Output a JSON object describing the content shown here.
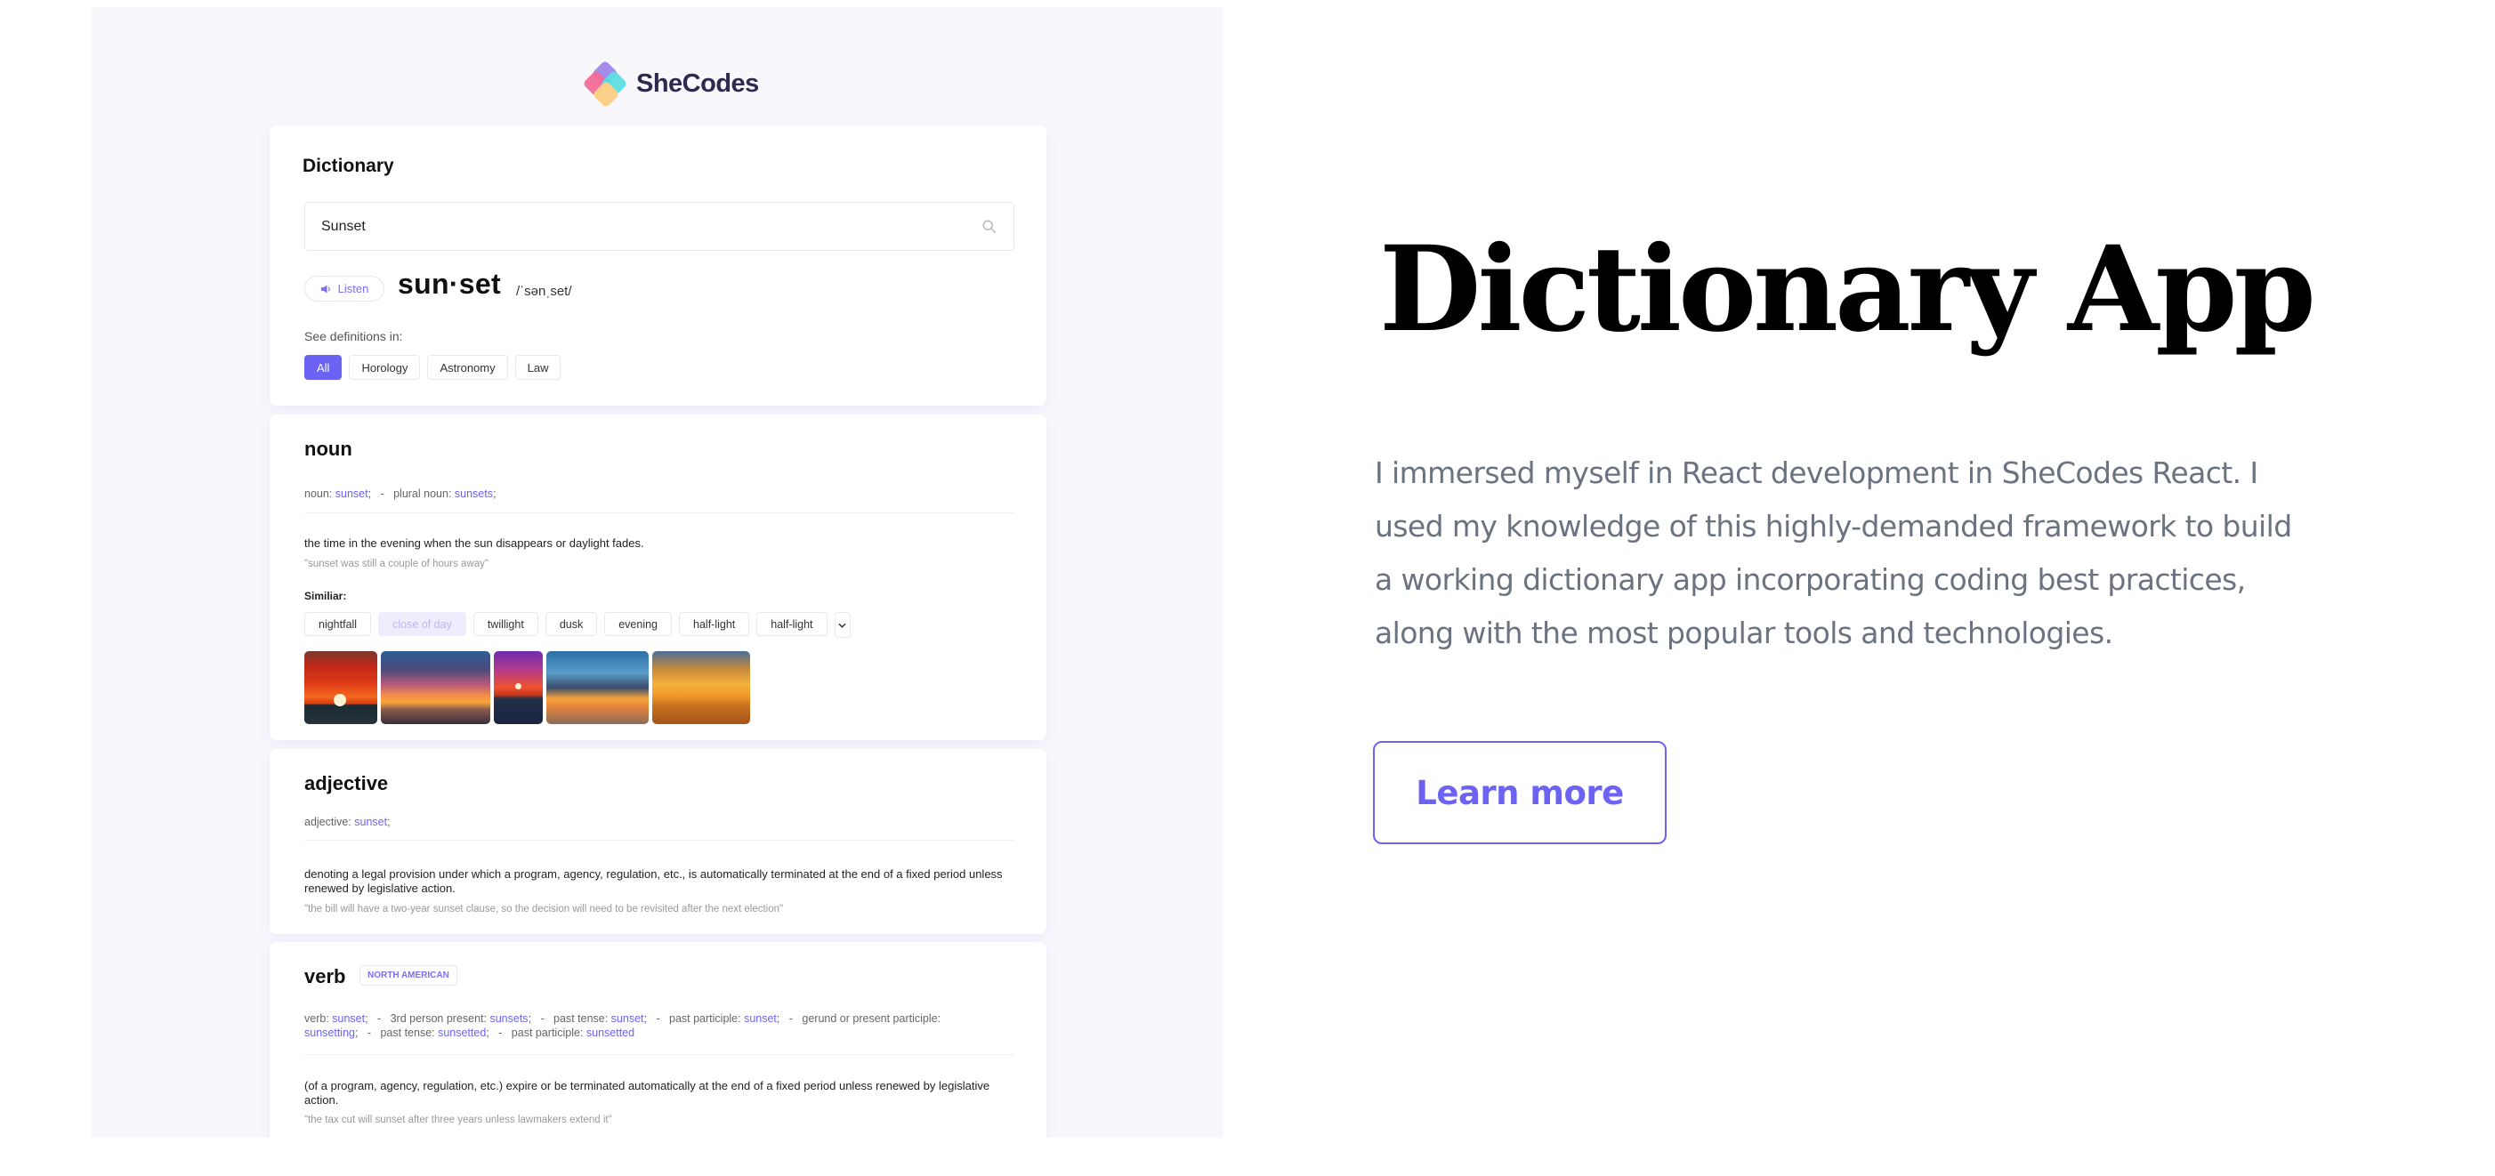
{
  "brand": {
    "name": "SheCodes"
  },
  "dictionary": {
    "title": "Dictionary",
    "search": {
      "value": "Sunset",
      "icon": "search-icon"
    },
    "listen_label": "Listen",
    "headword": "sun·set",
    "pronunciation": "/ˈsənˌset/",
    "see_definitions_label": "See definitions in:",
    "categories": [
      {
        "label": "All",
        "active": true
      },
      {
        "label": "Horology",
        "active": false
      },
      {
        "label": "Astronomy",
        "active": false
      },
      {
        "label": "Law",
        "active": false
      }
    ]
  },
  "noun": {
    "pos": "noun",
    "forms": [
      {
        "label": "noun: ",
        "word": "sunset"
      },
      {
        "label": "plural noun: ",
        "word": "sunsets"
      }
    ],
    "definition": "the time in the evening when the sun disappears or daylight fades.",
    "example": "\"sunset was still a couple of hours away\"",
    "similar_label": "Similiar:",
    "similar": [
      {
        "label": "nightfall",
        "dim": false
      },
      {
        "label": "close of day",
        "dim": true
      },
      {
        "label": "twillight",
        "dim": false
      },
      {
        "label": "dusk",
        "dim": false
      },
      {
        "label": "evening",
        "dim": false
      },
      {
        "label": "half-light",
        "dim": false
      },
      {
        "label": "half-light",
        "dim": false
      }
    ],
    "more_icon": "chevron-down-icon",
    "images": [
      {
        "alt": "sunset over sea with red sky"
      },
      {
        "alt": "sunset with blue clouds over ocean"
      },
      {
        "alt": "purple sky sunset with bird"
      },
      {
        "alt": "sun rays through clouds over sea"
      },
      {
        "alt": "golden sunset over water"
      }
    ]
  },
  "adjective": {
    "pos": "adjective",
    "forms": [
      {
        "label": "adjective: ",
        "word": "sunset"
      }
    ],
    "definition": "denoting a legal provision under which a program, agency, regulation, etc., is automatically terminated at the end of a fixed period unless renewed by legislative action.",
    "example": "\"the bill will have a two-year sunset clause, so the decision will need to be revisited after the next election\""
  },
  "verb": {
    "pos": "verb",
    "tag": "NORTH AMERICAN",
    "forms": [
      {
        "label": "verb: ",
        "word": "sunset"
      },
      {
        "label": "3rd person present: ",
        "word": "sunsets"
      },
      {
        "label": "past tense: ",
        "word": "sunset"
      },
      {
        "label": "past participle: ",
        "word": "sunset"
      },
      {
        "label": "gerund or present participle: ",
        "word": "sunsetting"
      },
      {
        "label": "past tense: ",
        "word": "sunsetted"
      },
      {
        "label": "past participle: ",
        "word": "sunsetted"
      }
    ],
    "definition": "(of a program, agency, regulation, etc.) expire or be terminated automatically at the end of a fixed period unless renewed by legislative action.",
    "example": "\"the tax cut will sunset after three years unless lawmakers extend it\""
  },
  "hero": {
    "title": "Dictionary App",
    "description": "I immersed myself in React development in SheCodes React. I used my knowledge of this highly-demanded framework to build a working dictionary app incorporating coding best practices, along with the most popular tools and technologies.",
    "button_label": "Learn more"
  },
  "colors": {
    "accent": "#6c63f5",
    "panel_bg": "#f7f7fc",
    "body_text": "#6b7280"
  }
}
